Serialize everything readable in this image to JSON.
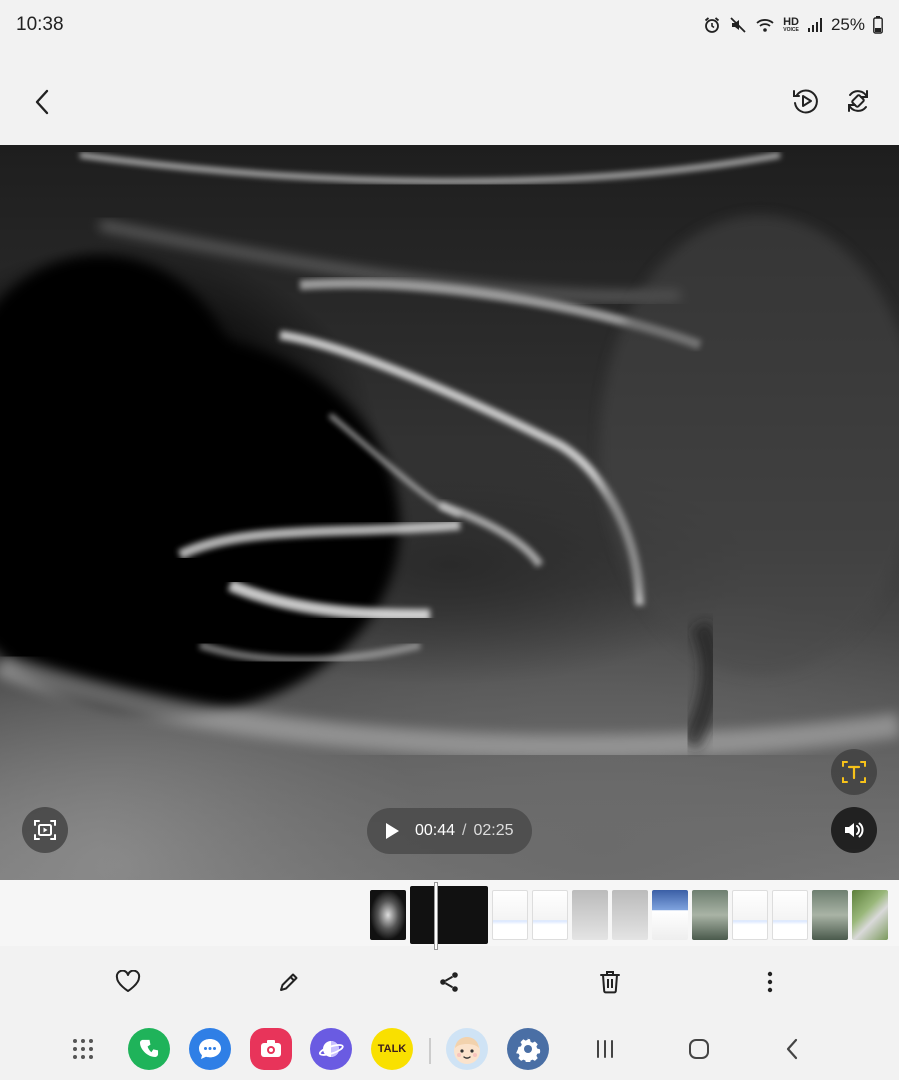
{
  "status": {
    "time": "10:38",
    "battery": "25%",
    "hd_label": "HD",
    "icons": [
      "alarm-icon",
      "mute-icon",
      "wifi-icon",
      "hd-voice-icon",
      "signal-icon",
      "battery-icon"
    ]
  },
  "top_bar": {
    "icons": [
      "back-icon",
      "motion-play-icon",
      "auto-rotate-icon"
    ]
  },
  "player": {
    "current_time": "00:44",
    "separator": "/",
    "total_time": "02:25",
    "progress": 0.303
  },
  "overlays": {
    "icons": [
      "ocr-text-icon",
      "volume-icon",
      "screen-capture-icon"
    ]
  },
  "filmstrip": {
    "thumbnails": [
      "ultrasound",
      "ultrasound-current",
      "document",
      "document",
      "gray",
      "gray",
      "blue-document",
      "photo",
      "document",
      "document",
      "photo",
      "map"
    ]
  },
  "actions": {
    "icons": [
      "favorite-icon",
      "edit-icon",
      "share-icon",
      "delete-icon",
      "more-icon"
    ]
  },
  "taskbar": {
    "talk_label": "TALK",
    "apps": [
      "app-drawer",
      "phone",
      "messages",
      "screen-recorder",
      "internet",
      "kakaotalk",
      "avatar",
      "settings"
    ],
    "nav": [
      "recents-icon",
      "home-icon",
      "back-nav-icon"
    ]
  },
  "colors": {
    "accent_green": "#1fb35a",
    "messages_blue": "#2f7fe6",
    "recorder_red": "#e8345a",
    "internet_purple": "#6a5be2",
    "kakao_yellow": "#f9e000",
    "settings_blue": "#4a6fa5",
    "ocr_yellow": "#f7c21a"
  }
}
